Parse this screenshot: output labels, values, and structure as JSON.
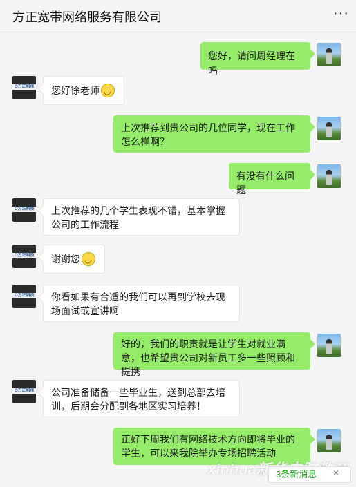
{
  "header": {
    "title": "方正宽带网络服务有限公司",
    "more": "···"
  },
  "company_avatar_text": "O方正科技",
  "messages": [
    {
      "side": "out",
      "text": "您好，请问周经理在吗"
    },
    {
      "side": "in",
      "text": "您好徐老师"
    },
    {
      "side": "out",
      "text": "上次推荐到贵公司的几位同学，现在工作怎么样啊？"
    },
    {
      "side": "out",
      "text": "有没有什么问题"
    },
    {
      "side": "in",
      "text": "上次推荐的几个学生表现不错，基本掌握公司的工作流程"
    },
    {
      "side": "in",
      "text": "谢谢您"
    },
    {
      "side": "in",
      "text": "你看如果有合适的我们可以再到学校去现场面试或宣讲啊"
    },
    {
      "side": "out",
      "text": "好的，我们的职责就是让学生对就业满意，也希望贵公司对新员工多一些照顾和提携"
    },
    {
      "side": "in",
      "text": "公司准备储备一些毕业生，送到总部去培训，后期会分配到各地区实习培养！"
    },
    {
      "side": "out",
      "text": "正好下周我们有网络技术方向即将毕业的学生，可以来我院举办专场招聘活动"
    }
  ],
  "new_messages_label": "3条新消息",
  "close_label": "×",
  "watermark": "xinhua新华电脑教育"
}
